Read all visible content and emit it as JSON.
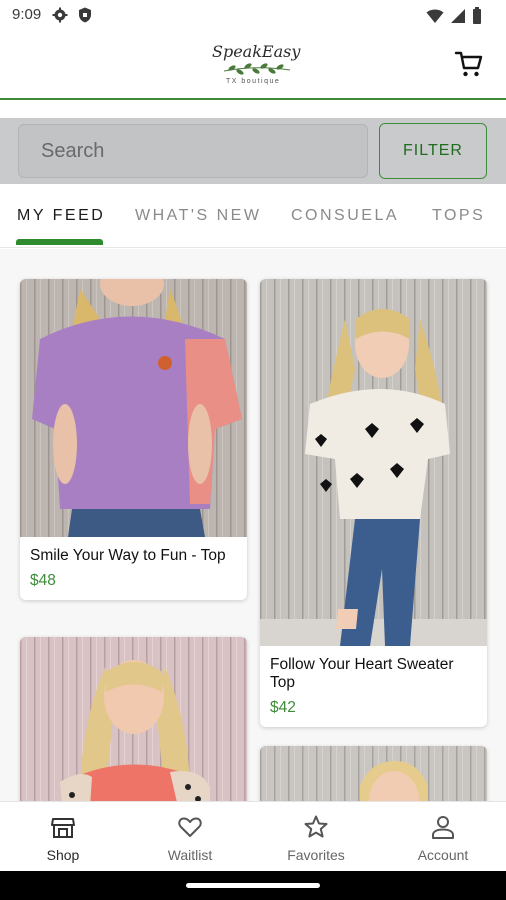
{
  "status_bar": {
    "time": "9:09"
  },
  "header": {
    "logo_text": "SpeakEasy",
    "logo_subtext": "TX boutique"
  },
  "search": {
    "placeholder": "Search",
    "filter_label": "FILTER"
  },
  "tabs": [
    {
      "label": "MY FEED",
      "active": true
    },
    {
      "label": "WHAT'S NEW",
      "active": false
    },
    {
      "label": "CONSUELA",
      "active": false
    },
    {
      "label": "TOPS",
      "active": false
    }
  ],
  "products": [
    {
      "title": "Smile Your Way to Fun - Top",
      "price": "$48",
      "image": "purple-top-photo"
    },
    {
      "title": "Follow Your Heart Sweater Top",
      "price": "$42",
      "image": "heart-sweater-photo"
    },
    {
      "title": "",
      "price": "",
      "image": "coral-leopard-top-photo"
    },
    {
      "title": "",
      "price": "",
      "image": "product-photo"
    }
  ],
  "bottom_nav": [
    {
      "label": "Shop",
      "icon": "shop-icon",
      "active": true
    },
    {
      "label": "Waitlist",
      "icon": "heart-icon",
      "active": false
    },
    {
      "label": "Favorites",
      "icon": "star-icon",
      "active": false
    },
    {
      "label": "Account",
      "icon": "person-icon",
      "active": false
    }
  ],
  "colors": {
    "accent_green": "#3e8c3a",
    "price_green": "#3e8c3a",
    "search_band": "#c9cacb"
  }
}
